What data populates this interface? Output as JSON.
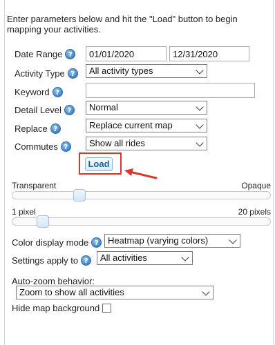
{
  "intro": "Enter parameters below and hit the \"Load\" button to begin mapping your activities.",
  "fields": {
    "date_range": {
      "label": "Date Range",
      "start": "01/01/2020",
      "end": "12/31/2020"
    },
    "activity_type": {
      "label": "Activity Type",
      "value": "All activity types"
    },
    "keyword": {
      "label": "Keyword",
      "value": ""
    },
    "detail_level": {
      "label": "Detail Level",
      "value": "Normal"
    },
    "replace": {
      "label": "Replace",
      "value": "Replace current map"
    },
    "commutes": {
      "label": "Commutes",
      "value": "Show all rides"
    }
  },
  "load_button": "Load",
  "sliders": {
    "opacity": {
      "min_label": "Transparent",
      "max_label": "Opaque",
      "value": 0.25
    },
    "line_width": {
      "min_label": "1 pixel",
      "max_label": "20 pixels",
      "value": 0.1
    }
  },
  "color_mode": {
    "label": "Color display mode",
    "value": "Heatmap (varying colors)"
  },
  "settings_apply": {
    "label": "Settings apply to",
    "value": "All activities"
  },
  "auto_zoom": {
    "label": "Auto-zoom behavior:",
    "value": "Zoom to show all activities"
  },
  "hide_bg": {
    "label": "Hide map background",
    "checked": false
  },
  "icons": {
    "help": "help-icon",
    "dropdown": "chevron-down-icon",
    "callout": "red-arrow-icon"
  },
  "colors": {
    "help_blue": "#3e83c7",
    "highlight_red": "#e0342b",
    "load_text": "#1f64a6"
  }
}
